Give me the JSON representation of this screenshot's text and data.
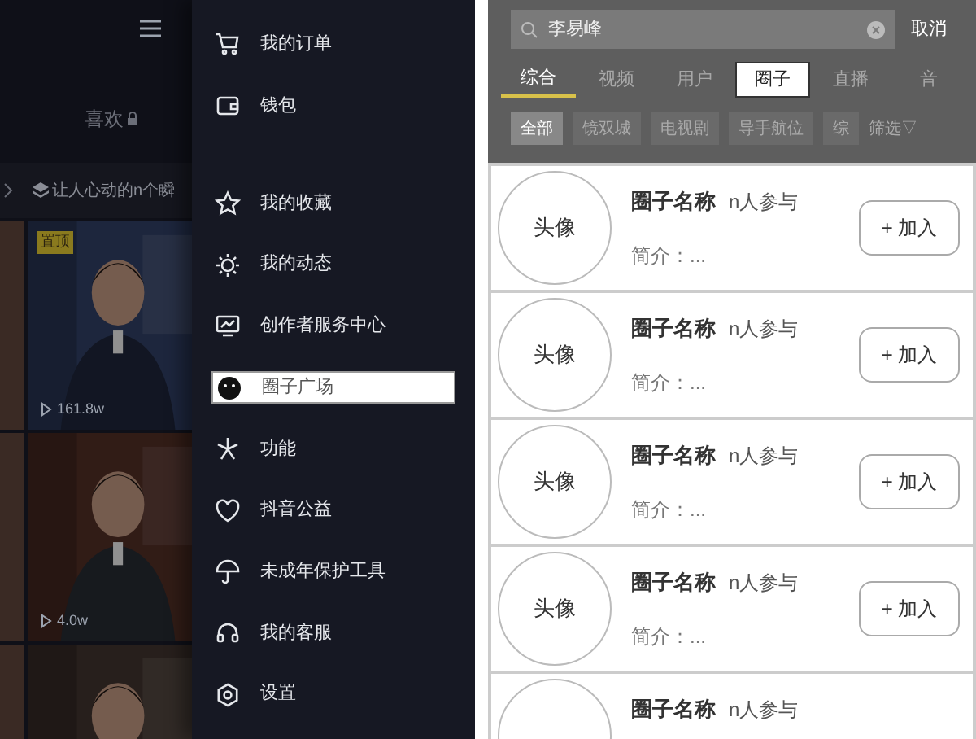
{
  "profile_backdrop": {
    "likes_tab": "喜欢",
    "collection_link": "让人心动的n个瞬",
    "videos": [
      {
        "kind": "picture",
        "badge": "置顶",
        "plays": "161.8w"
      },
      {
        "kind": "picture",
        "plays": "4.0w"
      },
      {
        "kind": "picture"
      }
    ]
  },
  "drawer_menu": [
    {
      "label": "我的订单",
      "selected": false
    },
    {
      "label": "钱包",
      "selected": false
    },
    {
      "label": "我的收藏",
      "selected": false
    },
    {
      "label": "我的动态",
      "selected": false
    },
    {
      "label": "创作者服务中心",
      "selected": false
    },
    {
      "label": "圈子广场",
      "selected": true
    },
    {
      "label": "功能",
      "selected": false
    },
    {
      "label": "抖音公益",
      "selected": false
    },
    {
      "label": "未成年保护工具",
      "selected": false
    },
    {
      "label": "我的客服",
      "selected": false
    },
    {
      "label": "设置",
      "selected": false
    }
  ],
  "search": {
    "value": "李易峰",
    "cancel": "取消"
  },
  "tabs": [
    {
      "label": "综合",
      "selected": true,
      "highlighted": false
    },
    {
      "label": "视频",
      "selected": false,
      "highlighted": false
    },
    {
      "label": "用户",
      "selected": false,
      "highlighted": false
    },
    {
      "label": "圈子",
      "selected": false,
      "highlighted": true
    },
    {
      "label": "直播",
      "selected": false,
      "highlighted": false
    },
    {
      "label": "音",
      "selected": false,
      "highlighted": false
    }
  ],
  "filters": [
    {
      "label": "全部",
      "selected": true
    },
    {
      "label": "镜双城",
      "selected": false
    },
    {
      "label": "电视剧",
      "selected": false
    },
    {
      "label": "导手航位",
      "selected": false
    },
    {
      "label": "综",
      "selected": false
    }
  ],
  "filter_button": "筛选▽",
  "circles": [
    {
      "avatar": "头像",
      "name": "圈子名称",
      "members": "n人参与",
      "intro": "简介：...",
      "join": "+ 加入"
    },
    {
      "avatar": "头像",
      "name": "圈子名称",
      "members": "n人参与",
      "intro": "简介：...",
      "join": "+ 加入"
    },
    {
      "avatar": "头像",
      "name": "圈子名称",
      "members": "n人参与",
      "intro": "简介：...",
      "join": "+ 加入"
    },
    {
      "avatar": "头像",
      "name": "圈子名称",
      "members": "n人参与",
      "intro": "简介：...",
      "join": "+ 加入"
    },
    {
      "name": "圈子名称",
      "members": "n人参与"
    }
  ]
}
